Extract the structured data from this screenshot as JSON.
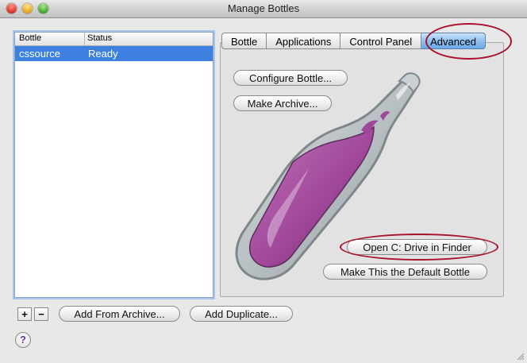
{
  "window": {
    "title": "Manage Bottles"
  },
  "bottles_list": {
    "columns": [
      "Bottle",
      "Status"
    ],
    "rows": [
      {
        "bottle": "cssource",
        "status": "Ready",
        "selected": true
      }
    ]
  },
  "list_controls": {
    "add_label": "+",
    "remove_label": "−",
    "add_from_archive": "Add From Archive...",
    "add_duplicate": "Add Duplicate..."
  },
  "tabs": [
    {
      "label": "Bottle",
      "active": false
    },
    {
      "label": "Applications",
      "active": false
    },
    {
      "label": "Control Panel",
      "active": false
    },
    {
      "label": "Advanced",
      "active": true
    }
  ],
  "advanced_panel": {
    "configure_bottle": "Configure Bottle...",
    "make_archive": "Make Archive...",
    "open_c_drive": "Open C: Drive in Finder",
    "make_default": "Make This the Default Bottle"
  },
  "help_label": "?",
  "colors": {
    "selection": "#3d80df",
    "annotation": "#a8122a",
    "wine": "#a0479a"
  },
  "icons": [
    "close-icon",
    "minimize-icon",
    "zoom-icon",
    "bottle-icon",
    "help-icon",
    "resize-grip-icon"
  ]
}
